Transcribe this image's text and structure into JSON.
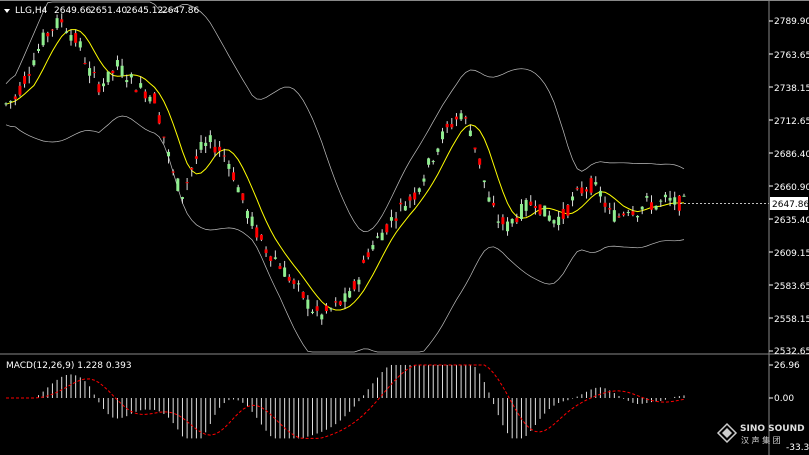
{
  "header": {
    "symbol": "LLG,H4",
    "open": "2649.66",
    "high": "2651.40",
    "low": "2645.12",
    "close": "2647.86"
  },
  "price_axis": {
    "ticks": [
      "2789.90",
      "2763.65",
      "2738.15",
      "2712.65",
      "2686.40",
      "2660.90",
      "2635.40",
      "2609.15",
      "2583.65",
      "2558.15",
      "2532.65"
    ],
    "current_price": "2647.86"
  },
  "macd": {
    "label": "MACD(12,26,9) 1.228 0.393",
    "ticks": [
      "26.96",
      "0.00",
      "-33.38"
    ]
  },
  "watermark": {
    "brand": "SINO SOUND",
    "sub": "汉 声 集 团"
  },
  "colors": {
    "background": "#000000",
    "bull": "#90EE90",
    "bear": "#FF0000",
    "ma": "#FFFF00",
    "bands": "#C0C0C0",
    "signal": "#FF0000",
    "text": "#FFFFFF"
  },
  "chart_data": {
    "type": "candlestick",
    "title": "LLG,H4",
    "ylim": [
      2532.65,
      2800
    ],
    "indicators": [
      "Bollinger Bands",
      "Moving Average",
      "MACD(12,26,9)"
    ],
    "close_path": [
      2725,
      2730,
      2745,
      2760,
      2775,
      2785,
      2790,
      2780,
      2770,
      2750,
      2740,
      2745,
      2755,
      2748,
      2740,
      2735,
      2730,
      2700,
      2670,
      2655,
      2675,
      2690,
      2695,
      2690,
      2680,
      2660,
      2640,
      2625,
      2612,
      2605,
      2595,
      2585,
      2575,
      2565,
      2560,
      2565,
      2570,
      2575,
      2590,
      2610,
      2620,
      2630,
      2640,
      2648,
      2655,
      2670,
      2685,
      2700,
      2710,
      2718,
      2705,
      2680,
      2650,
      2635,
      2630,
      2638,
      2645,
      2650,
      2640,
      2635,
      2638,
      2650,
      2658,
      2662,
      2655,
      2640,
      2638,
      2645,
      2642,
      2648,
      2646,
      2650,
      2648,
      2647.86
    ],
    "macd_ylim": [
      -33.38,
      26.96
    ]
  }
}
